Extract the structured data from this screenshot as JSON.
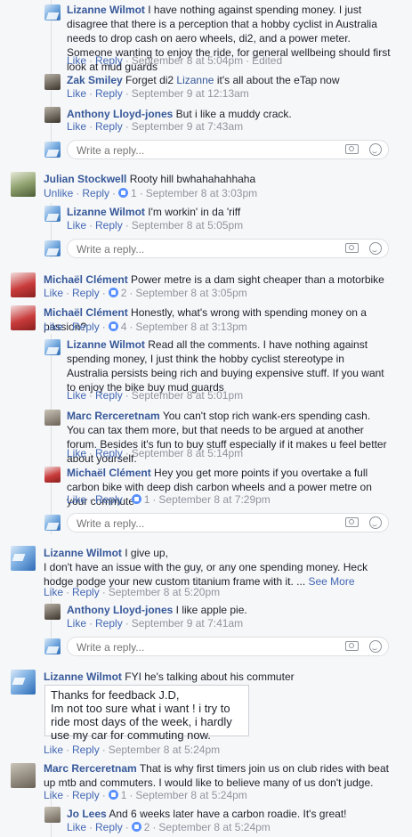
{
  "c1": {
    "name": "Lizanne Wilmot",
    "text": "I have nothing against spending money. I just disagree that there is a perception that a hobby cyclist in Australia needs to drop cash on aero wheels, di2, and a power meter. Someone wanting to enjoy the ride, for general wellbeing should first look at mud guards",
    "like": "Like",
    "reply": "Reply",
    "time": "September 8 at 5:04pm",
    "edited": "Edited"
  },
  "c2": {
    "name": "Zak Smiley",
    "text": "Forget di2",
    "mention": "Lizanne",
    "text2": "it's all about the eTap now",
    "like": "Like",
    "reply": "Reply",
    "time": "September 9 at 12:13am"
  },
  "c3": {
    "name": "Anthony Lloyd-jones",
    "text": "But i like a muddy crack.",
    "like": "Like",
    "reply": "Reply",
    "time": "September 9 at 7:43am"
  },
  "c4": {
    "name": "Julian Stockwell",
    "text": "Rooty hill bwhahahahhaha",
    "unlike": "Unlike",
    "reply": "Reply",
    "count": "1",
    "time": "September 8 at 3:03pm"
  },
  "c5": {
    "name": "Lizanne Wilmot",
    "text": "I'm workin' in da 'riff",
    "like": "Like",
    "reply": "Reply",
    "time": "September 8 at 5:05pm"
  },
  "c6": {
    "name": "Michaël Clément",
    "text": "Power metre is a dam sight cheaper than a motorbike",
    "like": "Like",
    "reply": "Reply",
    "count": "2",
    "time": "September 8 at 3:05pm"
  },
  "c7": {
    "name": "Michaël Clément",
    "text": "Honestly, what's wrong with spending money on a passion?",
    "like": "Like",
    "reply": "Reply",
    "count": "4",
    "time": "September 8 at 3:13pm"
  },
  "c8": {
    "name": "Lizanne Wilmot",
    "text": "Read all the comments. I have nothing against spending money, I just think the hobby cyclist stereotype in Australia persists being rich and buying expensive stuff. If you want to enjoy the bike buy mud guards",
    "like": "Like",
    "reply": "Reply",
    "time": "September 8 at 5:01pm"
  },
  "c9": {
    "name": "Marc Rerceretnam",
    "text": "You can't stop rich wank-ers spending cash. You can tax them more, but that needs to be argued at another forum. Besides it's fun to buy stuff especially if it makes u feel better about yourself.",
    "like": "Like",
    "reply": "Reply",
    "time": "September 8 at 5:14pm"
  },
  "c10": {
    "name": "Michaël Clément",
    "text": "Hey you get more points if you overtake a full carbon bike with deep dish carbon wheels and a power metre on your commute",
    "like": "Like",
    "reply": "Reply",
    "count": "1",
    "time": "September 8 at 7:29pm"
  },
  "c11": {
    "name": "Lizanne Wilmot",
    "text": "I give up,",
    "text2": "I don't have an issue with the guy, or any one spending money. Heck hodge podge your new custom titanium frame with it. ...",
    "seemore": "See More",
    "like": "Like",
    "reply": "Reply",
    "time": "September 8 at 5:20pm"
  },
  "c12": {
    "name": "Anthony Lloyd-jones",
    "text": "I like apple pie.",
    "like": "Like",
    "reply": "Reply",
    "time": "September 9 at 7:41am"
  },
  "c13": {
    "name": "Lizanne Wilmot",
    "text": "FYI he's talking about his commuter",
    "note": "Thanks for feedback J.D,\nIm not too sure what i want ! i try to ride most days of the week, i hardly use my car for commuting now.",
    "like": "Like",
    "reply": "Reply",
    "time": "September 8 at 5:24pm"
  },
  "c14": {
    "name": "Marc Rerceretnam",
    "text": "That is why first timers join us on club rides with beat up mtb and commuters. I would like to believe many of us don't judge.",
    "like": "Like",
    "reply": "Reply",
    "count": "1",
    "time": "September 8 at 5:24pm"
  },
  "c15": {
    "name": "Jo Lees",
    "text": "And 6 weeks later have a carbon roadie. It's great!",
    "like": "Like",
    "reply": "Reply",
    "count": "2",
    "time": "September 8 at 5:24pm"
  },
  "reply_placeholder": "Write a reply...",
  "dot": "·",
  "colors": {
    "link": "#365899",
    "action": "#4267b2",
    "meta": "#90949c",
    "bg": "#f6f7f9"
  }
}
